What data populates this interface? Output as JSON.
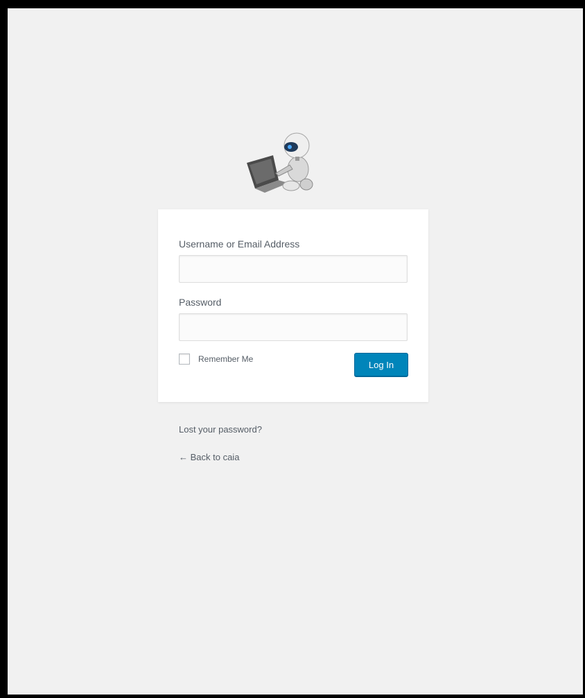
{
  "form": {
    "username_label": "Username or Email Address",
    "username_value": "",
    "password_label": "Password",
    "password_value": "",
    "remember_label": "Remember Me",
    "remember_checked": false,
    "submit_label": "Log In"
  },
  "links": {
    "lost_password": "Lost your password?",
    "back_to_site": "← Back to caia"
  },
  "logo": {
    "icon": "robot-with-laptop-icon"
  },
  "colors": {
    "page_background": "#f1f1f1",
    "frame_border": "#000000",
    "card_background": "#ffffff",
    "button_primary": "#0085ba",
    "label_text": "#555d66"
  }
}
